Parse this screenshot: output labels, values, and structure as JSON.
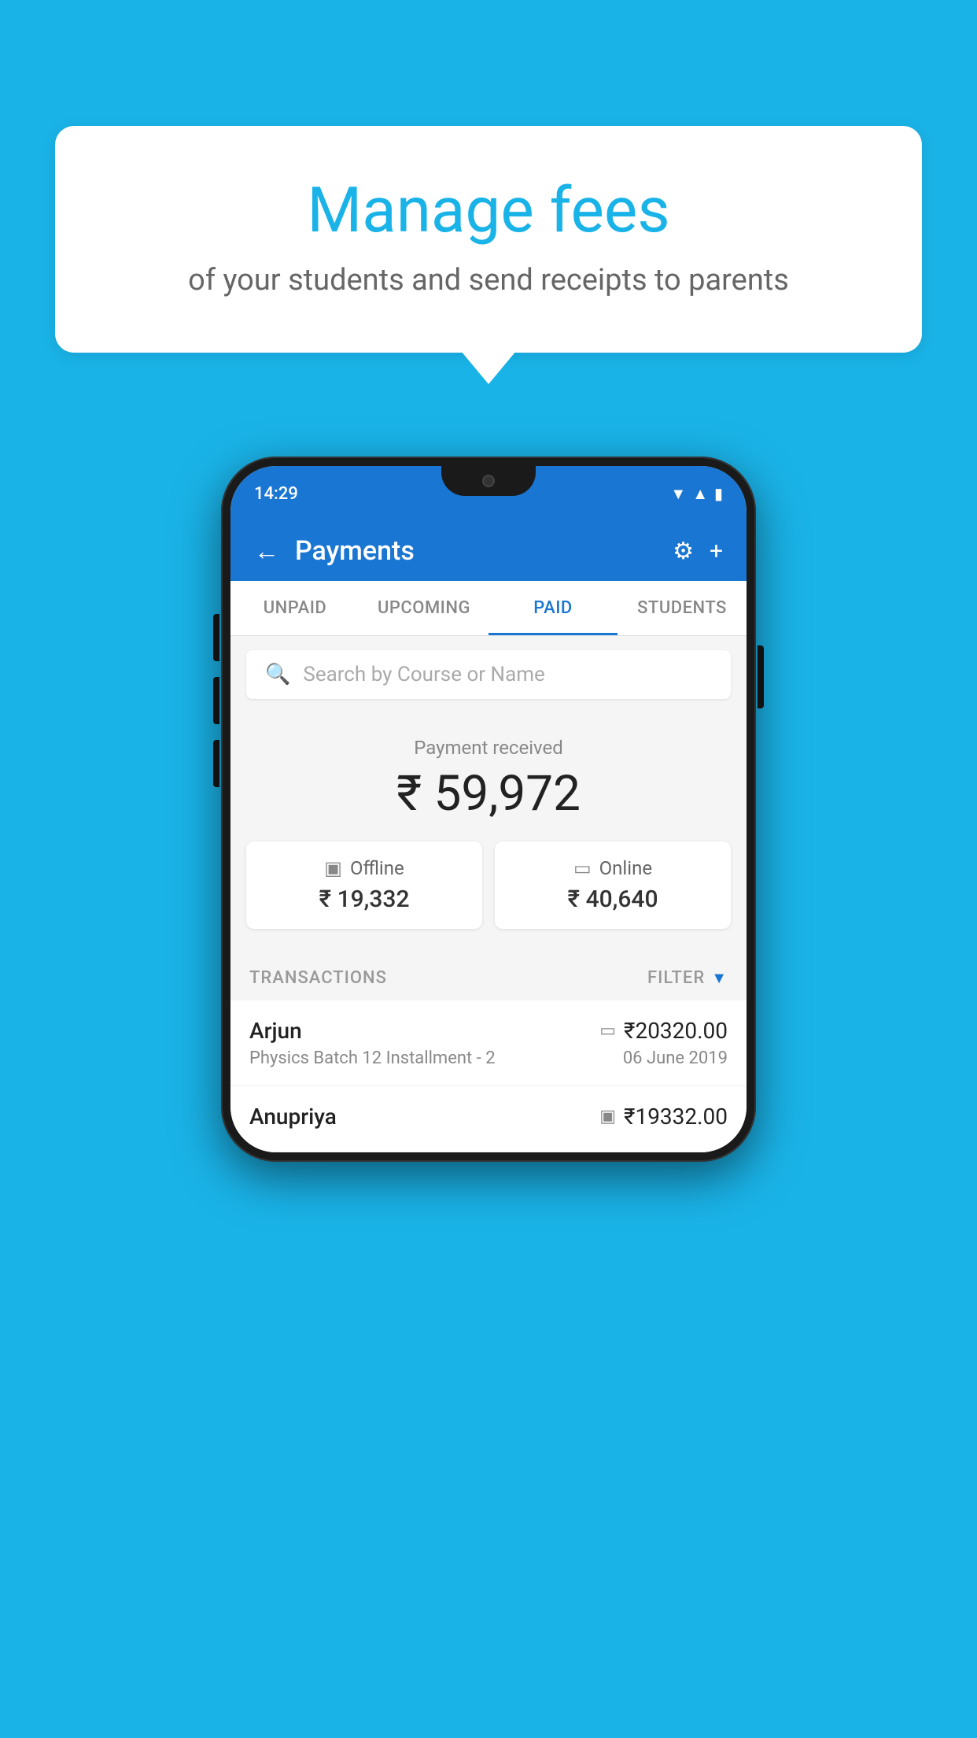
{
  "background_color": "#1ab3e8",
  "speech_bubble": {
    "title": "Manage fees",
    "subtitle": "of your students and send receipts to parents"
  },
  "phone": {
    "status_bar": {
      "time": "14:29"
    },
    "app_header": {
      "title": "Payments",
      "back_label": "←",
      "settings_icon": "⚙",
      "add_icon": "+"
    },
    "tabs": [
      {
        "label": "UNPAID",
        "active": false
      },
      {
        "label": "UPCOMING",
        "active": false
      },
      {
        "label": "PAID",
        "active": true
      },
      {
        "label": "STUDENTS",
        "active": false
      }
    ],
    "search": {
      "placeholder": "Search by Course or Name"
    },
    "payment_received": {
      "label": "Payment received",
      "amount": "₹ 59,972",
      "offline_label": "Offline",
      "offline_amount": "₹ 19,332",
      "online_label": "Online",
      "online_amount": "₹ 40,640"
    },
    "transactions": {
      "header": "TRANSACTIONS",
      "filter": "FILTER",
      "items": [
        {
          "name": "Arjun",
          "description": "Physics Batch 12 Installment - 2",
          "amount": "₹20320.00",
          "date": "06 June 2019",
          "type": "online"
        },
        {
          "name": "Anupriya",
          "description": "",
          "amount": "₹19332.00",
          "date": "",
          "type": "offline"
        }
      ]
    }
  }
}
